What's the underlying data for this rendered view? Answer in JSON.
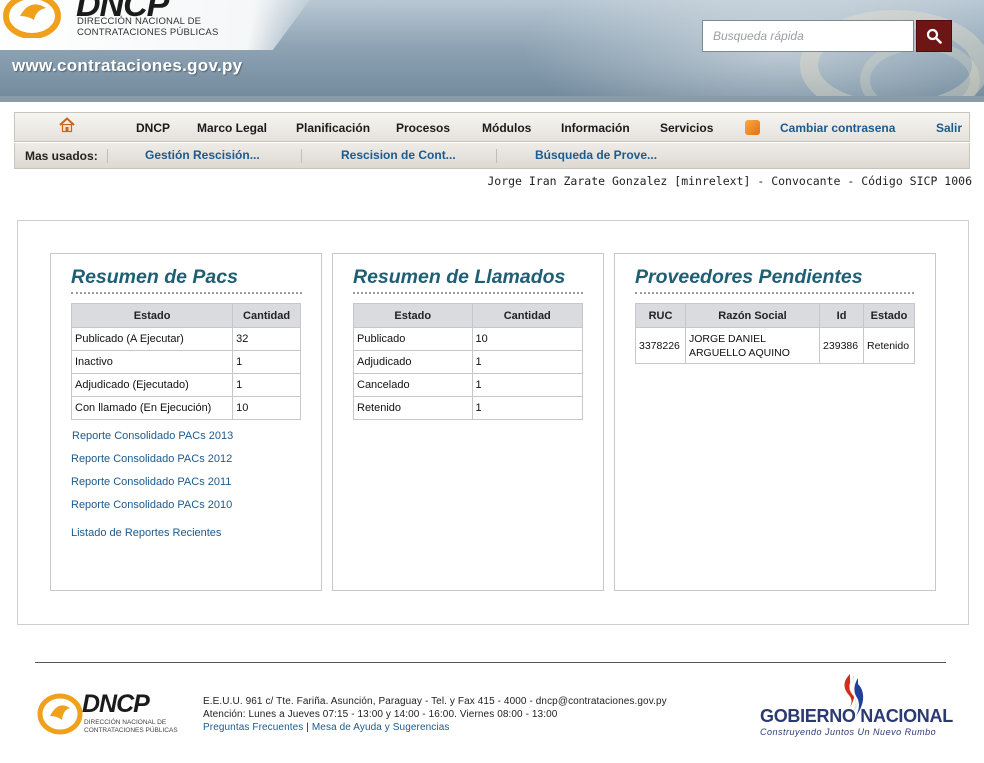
{
  "header": {
    "logo_text": "DNCP",
    "logo_line1": "DIRECCIÓN NACIONAL DE",
    "logo_line2": "CONTRATACIONES PÚBLICAS",
    "site_url": "www.contrataciones.gov.py",
    "search_placeholder": "Busqueda rápida"
  },
  "nav": {
    "items": [
      "DNCP",
      "Marco Legal",
      "Planificación",
      "Procesos",
      "Módulos",
      "Información",
      "Servicios"
    ],
    "change_password": "Cambiar contrasena",
    "logout": "Salir"
  },
  "subnav": {
    "label": "Mas usados:",
    "links": [
      "Gestión Rescisión...",
      "Rescision de Cont...",
      "Búsqueda de Prove..."
    ]
  },
  "user_line": "Jorge Iran Zarate Gonzalez [minrelext] - Convocante - Código SICP 1006",
  "pacs": {
    "title": "Resumen de Pacs",
    "headers": [
      "Estado",
      "Cantidad"
    ],
    "rows": [
      [
        "Publicado (A Ejecutar)",
        "32"
      ],
      [
        "Inactivo",
        "1"
      ],
      [
        "Adjudicado (Ejecutado)",
        "1"
      ],
      [
        "Con llamado (En Ejecución)",
        "10"
      ]
    ],
    "reports": [
      "Reporte Consolidado PACs 2013",
      "Reporte Consolidado PACs 2012",
      "Reporte Consolidado PACs 2011",
      "Reporte Consolidado PACs 2010"
    ],
    "recent_reports": "Listado de Reportes Recientes"
  },
  "llamados": {
    "title": "Resumen de Llamados",
    "headers": [
      "Estado",
      "Cantidad"
    ],
    "rows": [
      [
        "Publicado",
        "10"
      ],
      [
        "Adjudicado",
        "1"
      ],
      [
        "Cancelado",
        "1"
      ],
      [
        "Retenido",
        "1"
      ]
    ]
  },
  "proveedores": {
    "title": "Proveedores Pendientes",
    "headers": [
      "RUC",
      "Razón Social",
      "Id",
      "Estado"
    ],
    "rows": [
      [
        "3378226",
        "JORGE DANIEL ARGUELLO AQUINO",
        "239386",
        "Retenido"
      ]
    ]
  },
  "footer": {
    "logo_text": "DNCP",
    "logo_line1": "DIRECCIÓN NACIONAL DE",
    "logo_line2": "CONTRATACIONES PÚBLICAS",
    "address": "E.E.U.U. 961 c/ Tte. Fariña. Asunción, Paraguay - Tel. y Fax 415 - 4000 - dncp@contrataciones.gov.py",
    "hours": "Atención: Lunes a Jueves 07:15 - 13:00 y 14:00 - 16:00. Viernes 08:00 - 13:00",
    "faq": "Preguntas Frecuentes",
    "separator": "|",
    "help": "Mesa de Ayuda y Sugerencias",
    "gov_title": "GOBIERNO NACIONAL",
    "gov_tagline": "Construyendo Juntos Un Nuevo Rumbo"
  },
  "colors": {
    "link": "#1d5a8e",
    "panel_title": "#1f5f74",
    "search_button": "#6e1515",
    "gov_blue": "#2b3a73"
  }
}
